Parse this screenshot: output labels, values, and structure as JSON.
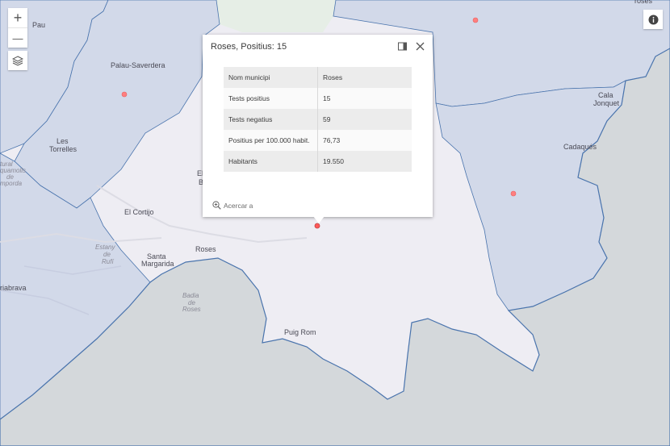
{
  "map": {
    "labels": {
      "pau": "Pau",
      "palau": "Palau-Saverdera",
      "les": "Les",
      "torrelles": "Torrelles",
      "elcortijo": "El Cortijo",
      "santa": "Santa",
      "margarida": "Margarida",
      "roses": "Roses",
      "puig_rom": "Puig Rom",
      "cala": "Cala",
      "jonquet": "Jonquet",
      "cadaques": "Cadaqués",
      "riabrava": "riabrava",
      "el_partial": "El",
      "b_partial": "B",
      "estany_1": "Estany",
      "estany_2": "de",
      "estany_3": "Rufí",
      "badia_1": "Badia",
      "badia_2": "de",
      "badia_3": "Roses",
      "emporda_1": "tural",
      "emporda_2": "quamolls",
      "emporda_3": "de",
      "emporda_4": "mporda",
      "roses_top": "roses"
    },
    "colors": {
      "land": "#eeedf3",
      "municipality_fill": "#d2d9e9",
      "boundary": "#4a74ad",
      "sea": "#d4d8db",
      "green_area": "#e6eee6",
      "case_point": "#ff7f7f"
    }
  },
  "controls": {
    "zoom_in": "+",
    "zoom_out": "—",
    "layers_icon": "layers-icon",
    "info_icon": "info-icon"
  },
  "popup": {
    "title": "Roses, Positius: 15",
    "rows": [
      {
        "key": "Nom municipi",
        "value": "Roses"
      },
      {
        "key": "Tests positius",
        "value": "15"
      },
      {
        "key": "Tests negatius",
        "value": "59"
      },
      {
        "key": "Positius per 100.000 habit.",
        "value": "76,73"
      },
      {
        "key": "Habitants",
        "value": "19.550"
      }
    ],
    "zoom_to": "Acercar a"
  }
}
